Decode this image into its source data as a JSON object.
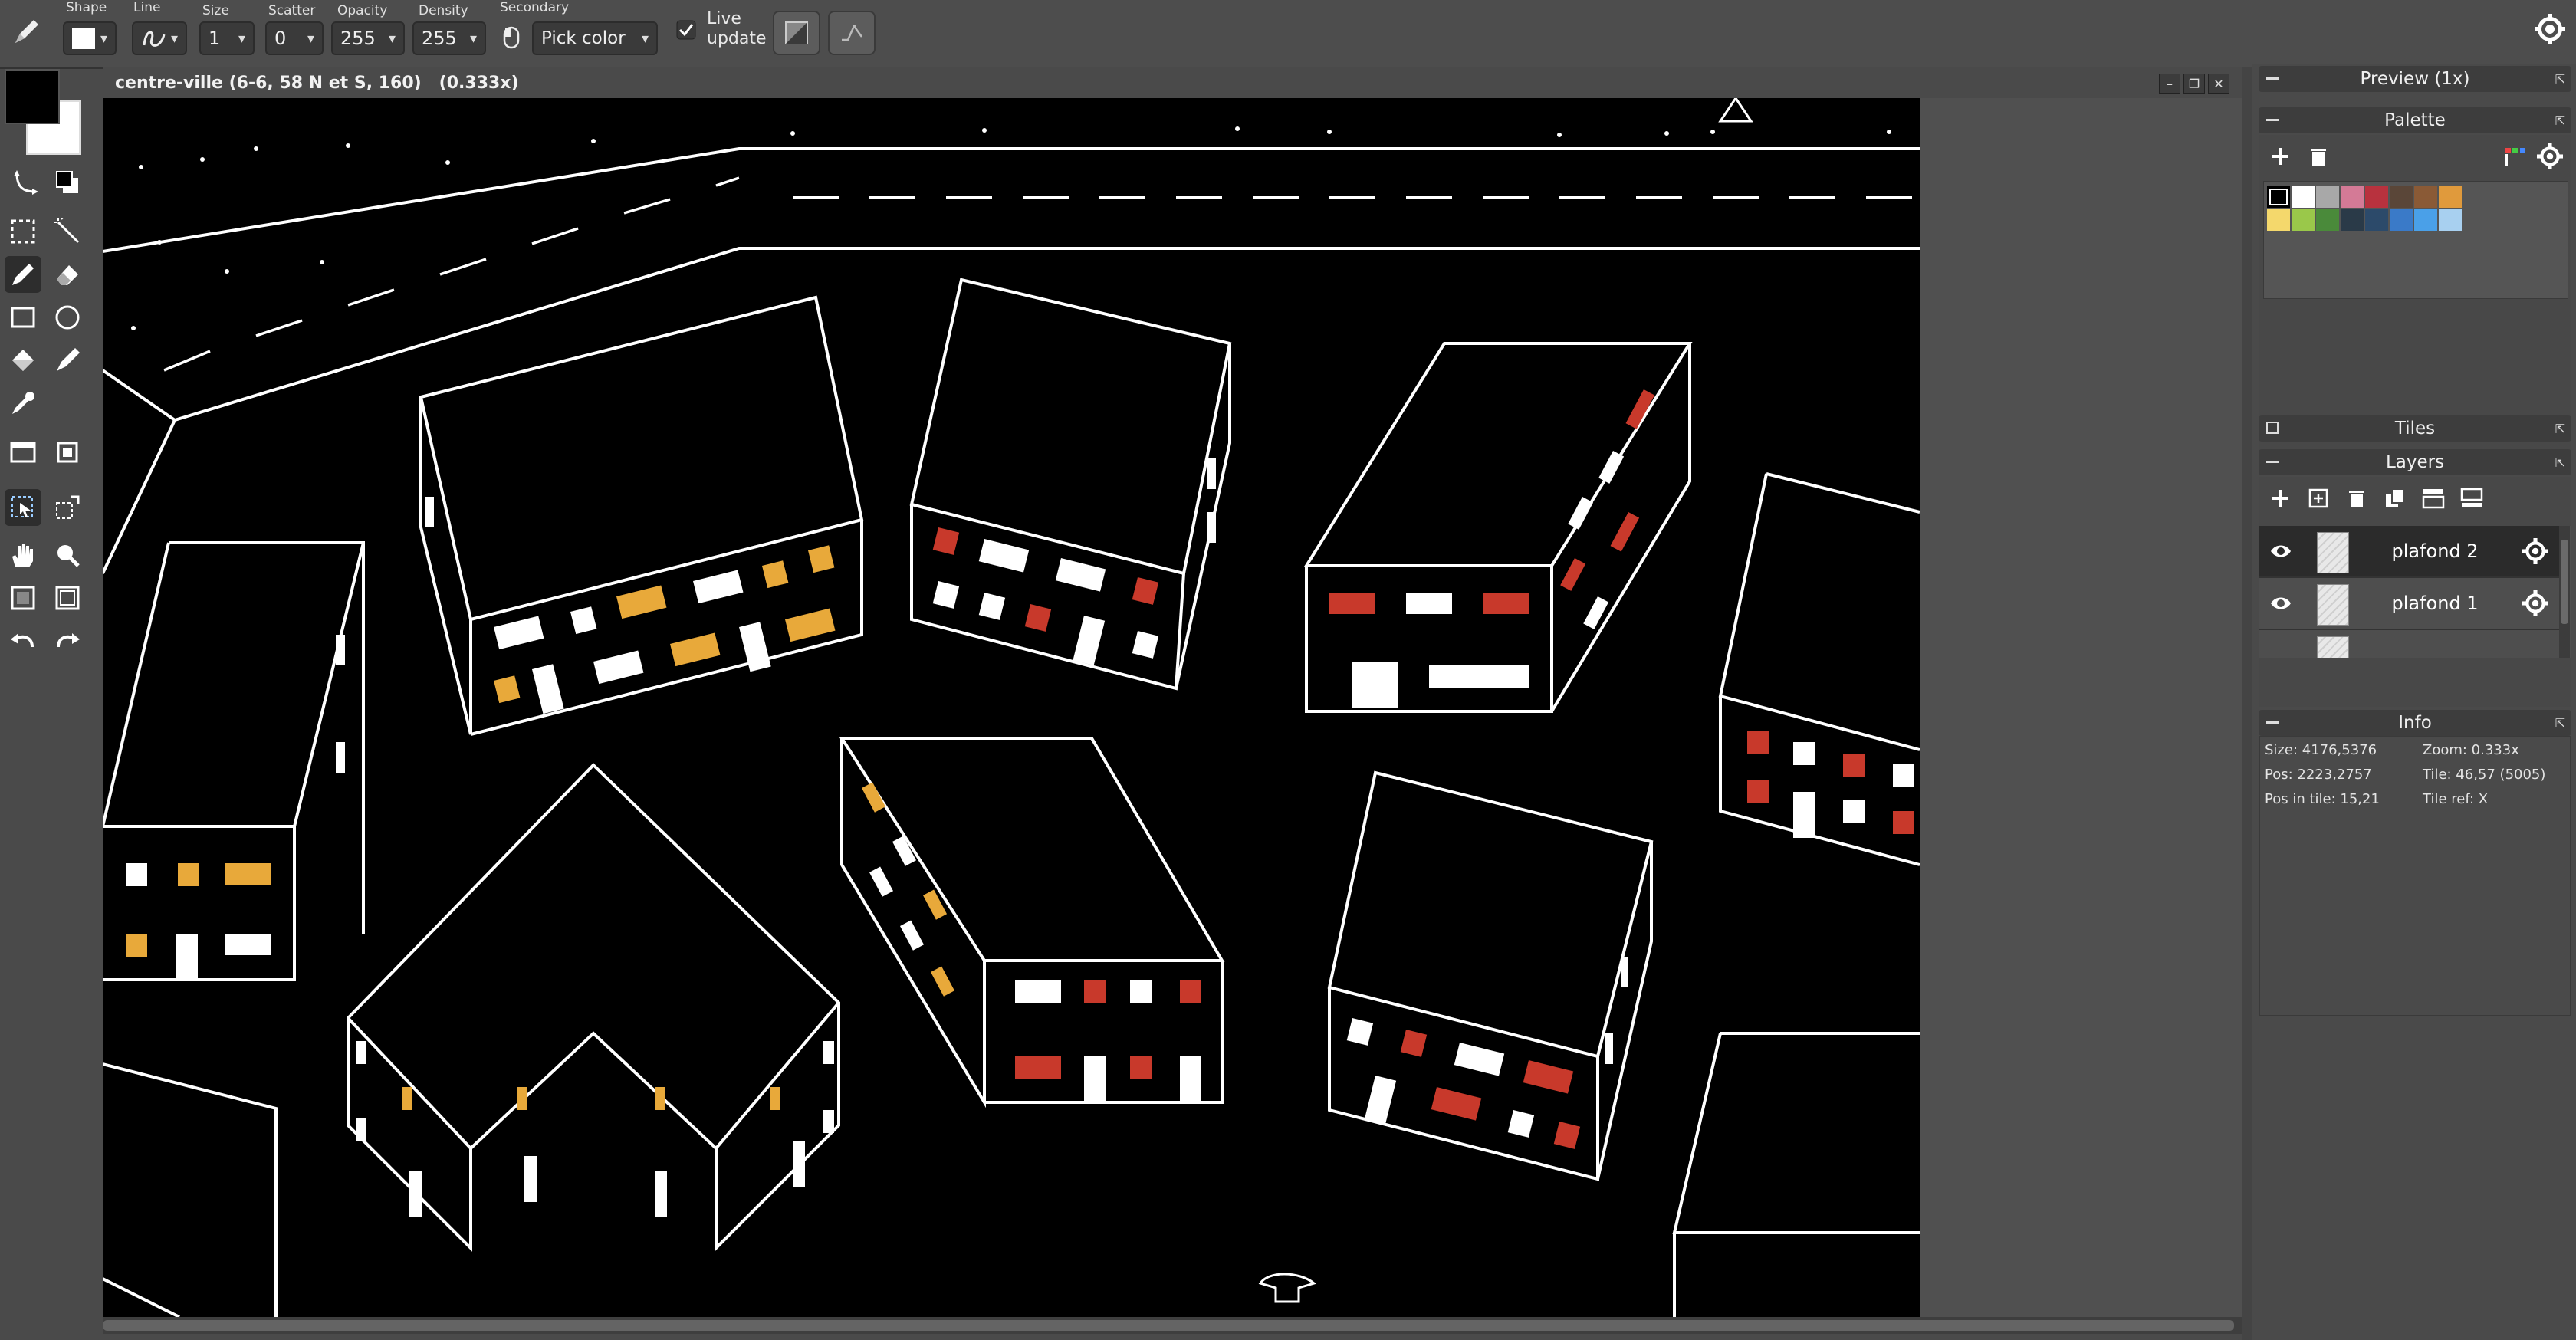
{
  "toolbar": {
    "shape_label": "Shape",
    "line_label": "Line",
    "size_label": "Size",
    "size_value": "1",
    "scatter_label": "Scatter",
    "scatter_value": "0",
    "opacity_label": "Opacity",
    "opacity_value": "255",
    "density_label": "Density",
    "density_value": "255",
    "secondary_label": "Secondary",
    "secondary_value": "Pick color",
    "live_update_line1": "Live",
    "live_update_line2": "update",
    "live_update_checked": true
  },
  "colors": {
    "primary": "#000000",
    "secondary": "#ffffff",
    "accent_orange": "#e8a93a",
    "accent_red": "#c8392b"
  },
  "document": {
    "title": "centre-ville (6-6, 58 N et S, 160)   (0.333x)"
  },
  "panels": {
    "preview_title": "Preview (1x)",
    "palette_title": "Palette",
    "tiles_title": "Tiles",
    "layers_title": "Layers",
    "info_title": "Info"
  },
  "palette": {
    "row1": [
      "#000000",
      "#ffffff",
      "#a8a8a8",
      "#d47a96",
      "#b8323e",
      "#5a4638",
      "#8a5a36",
      "#e09a3c"
    ],
    "row2": [
      "#f4d86c",
      "#9ac84a",
      "#4a8a3a",
      "#2a3a48",
      "#2c4a6a",
      "#3a7ac8",
      "#4aa0e8",
      "#a8d0f0"
    ]
  },
  "layers": [
    {
      "name": "plafond 2",
      "selected": true
    },
    {
      "name": "plafond 1",
      "selected": false
    }
  ],
  "info": {
    "size": "Size: 4176,5376",
    "zoom": "Zoom: 0.333x",
    "pos": "Pos: 2223,2757",
    "tile": "Tile: 46,57 (5005)",
    "pos_in_tile": "Pos in tile: 15,21",
    "tile_ref": "Tile ref: X"
  }
}
